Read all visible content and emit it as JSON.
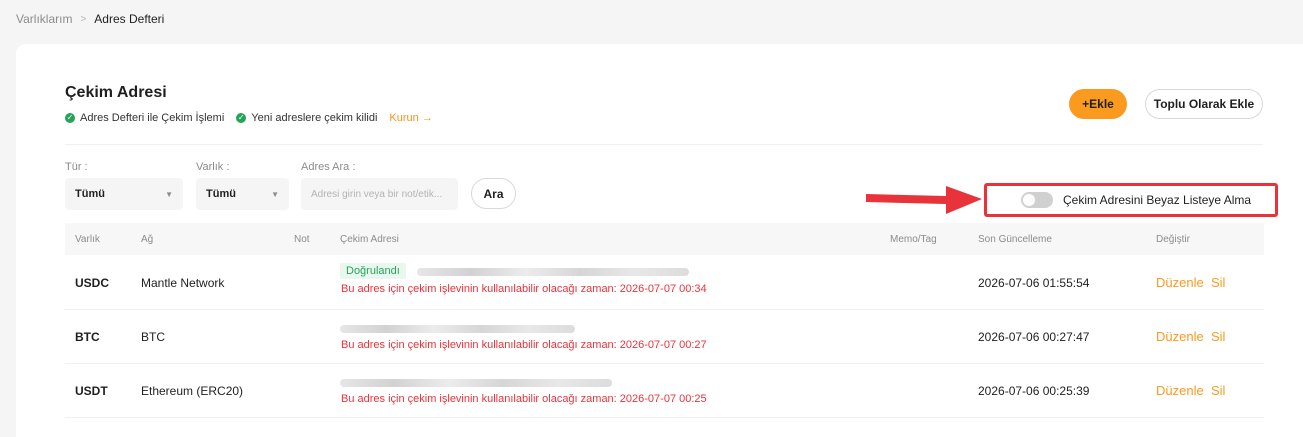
{
  "breadcrumb": {
    "parent": "Varlıklarım",
    "separator": ">",
    "current": "Adres Defteri"
  },
  "header": {
    "title": "Çekim Adresi",
    "status": [
      {
        "label": "Adres Defteri ile Çekim İşlemi",
        "state": "enabled"
      },
      {
        "label": "Yeni adreslere çekim kilidi",
        "state": "enabled"
      }
    ],
    "setup_link": "Kurun →",
    "add_button": "+Ekle",
    "bulk_button": "Toplu Olarak Ekle"
  },
  "filters": {
    "type_label": "Tür :",
    "type_value": "Tümü",
    "asset_label": "Varlık :",
    "asset_value": "Tümü",
    "search_label": "Adres Ara :",
    "search_placeholder": "Adresi girin veya bir not/etik...",
    "search_button": "Ara"
  },
  "whitelist": {
    "label": "Çekim Adresini Beyaz Listeye Alma",
    "enabled": false
  },
  "table": {
    "columns": {
      "asset": "Varlık",
      "network": "Ağ",
      "note": "Not",
      "address": "Çekim Adresi",
      "memo": "Memo/Tag",
      "updated": "Son Güncelleme",
      "action": "Değiştir"
    },
    "rows": [
      {
        "asset": "USDC",
        "network": "Mantle Network",
        "verified": "Doğrulandı",
        "warning": "Bu adres için çekim işlevinin kullanılabilir olacağı zaman: 2026-07-07 00:34",
        "updated": "2026-07-06 01:55:54",
        "edit": "Düzenle",
        "delete": "Sil"
      },
      {
        "asset": "BTC",
        "network": "BTC",
        "warning": "Bu adres için çekim işlevinin kullanılabilir olacağı zaman: 2026-07-07 00:27",
        "updated": "2026-07-06 00:27:47",
        "edit": "Düzenle",
        "delete": "Sil"
      },
      {
        "asset": "USDT",
        "network": "Ethereum (ERC20)",
        "warning": "Bu adres için çekim işlevinin kullanılabilir olacağı zaman: 2026-07-07 00:25",
        "updated": "2026-07-06 00:25:39",
        "edit": "Düzenle",
        "delete": "Sil"
      }
    ]
  },
  "colors": {
    "accent": "#fa9a1e",
    "success": "#23a559",
    "danger": "#e8333b"
  },
  "icons": [
    "check-circle-icon",
    "chevron-right-icon",
    "caret-down-icon",
    "arrow-right-icon"
  ]
}
